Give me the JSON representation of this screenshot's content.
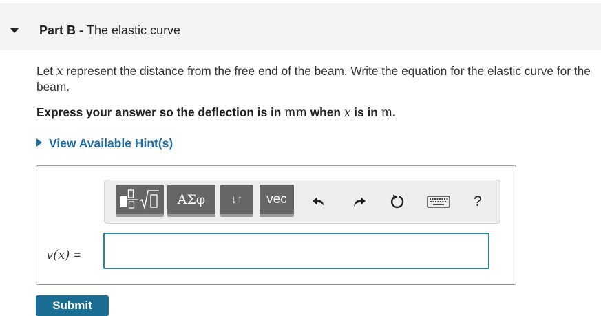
{
  "part": {
    "label": "Part B",
    "separator": " - ",
    "title": "The elastic curve"
  },
  "prompt": {
    "pre": "Let ",
    "var": "x",
    "post": " represent the distance from the free end of the beam. Write the equation for the elastic curve for the beam."
  },
  "express": {
    "t1": "Express your answer so the deflection is in ",
    "unit1": "mm",
    "t2": " when ",
    "var": "x",
    "t3": " is in ",
    "unit2": "m",
    "t4": "."
  },
  "hint": {
    "label": "View Available Hint(s)"
  },
  "toolbar": {
    "symbols_label": "ΑΣφ",
    "arrows_label": "↓↑",
    "vec_label": "vec",
    "help_label": "?",
    "icons": [
      "templates-icon",
      "greek-symbols-icon",
      "arrows-icon",
      "vector-icon",
      "undo-icon",
      "redo-icon",
      "reset-icon",
      "keyboard-icon",
      "help-icon"
    ]
  },
  "answer": {
    "lhs": "v(x)",
    "equals": "=",
    "value": ""
  },
  "submit": {
    "label": "Submit"
  },
  "colors": {
    "header_bg": "#f3f3f3",
    "link": "#1c6aa8",
    "input_border": "#2a8596",
    "toolbar_button": "#666666",
    "submit_bg": "#1a6e93"
  }
}
